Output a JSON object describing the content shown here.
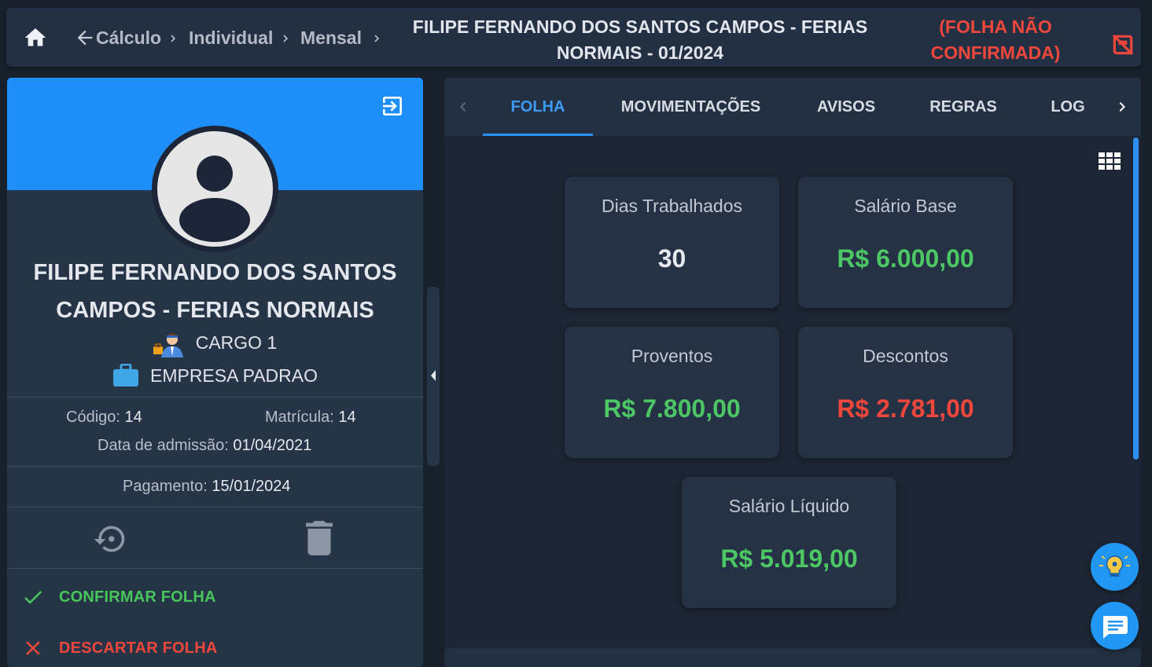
{
  "header": {
    "breadcrumbs": [
      "Cálculo",
      "Individual",
      "Mensal"
    ],
    "title": "FILIPE FERNANDO DOS SANTOS CAMPOS - FERIAS NORMAIS - 01/2024",
    "status": "(FOLHA NÃO CONFIRMADA)",
    "icons": [
      "home-icon",
      "arrow-left-icon",
      "chevron-right-icon",
      "print-disabled-icon"
    ],
    "status_color": "#f0473c"
  },
  "employee": {
    "name": "FILIPE FERNANDO DOS SANTOS CAMPOS - FERIAS NORMAIS",
    "role": "CARGO 1",
    "company": "EMPRESA PADRAO",
    "codigo_label": "Código:",
    "codigo": "14",
    "matricula_label": "Matrícula:",
    "matricula": "14",
    "admissao_label": "Data de admissão:",
    "admissao": "01/04/2021",
    "pagamento_label": "Pagamento:",
    "pagamento": "15/01/2024",
    "header_color": "#1e8ff8"
  },
  "actions": {
    "confirm_label": "CONFIRMAR FOLHA",
    "discard_label": "DESCARTAR FOLHA",
    "confirm_color": "#47c65a",
    "discard_color": "#f0473c"
  },
  "tabs": {
    "items": [
      "FOLHA",
      "MOVIMENTAÇÕES",
      "AVISOS",
      "REGRAS",
      "LOG"
    ],
    "active": "FOLHA",
    "accent": "#2f8ff0"
  },
  "cards": [
    {
      "label": "Dias Trabalhados",
      "value": "30",
      "color": "#e6e9ee"
    },
    {
      "label": "Salário Base",
      "value": "R$ 6.000,00",
      "color": "#4cc764"
    },
    {
      "label": "Proventos",
      "value": "R$ 7.800,00",
      "color": "#4cc764"
    },
    {
      "label": "Descontos",
      "value": "R$ 2.781,00",
      "color": "#f0473c"
    },
    {
      "label": "Salário Líquido",
      "value": "R$ 5.019,00",
      "color": "#4cc764"
    }
  ]
}
